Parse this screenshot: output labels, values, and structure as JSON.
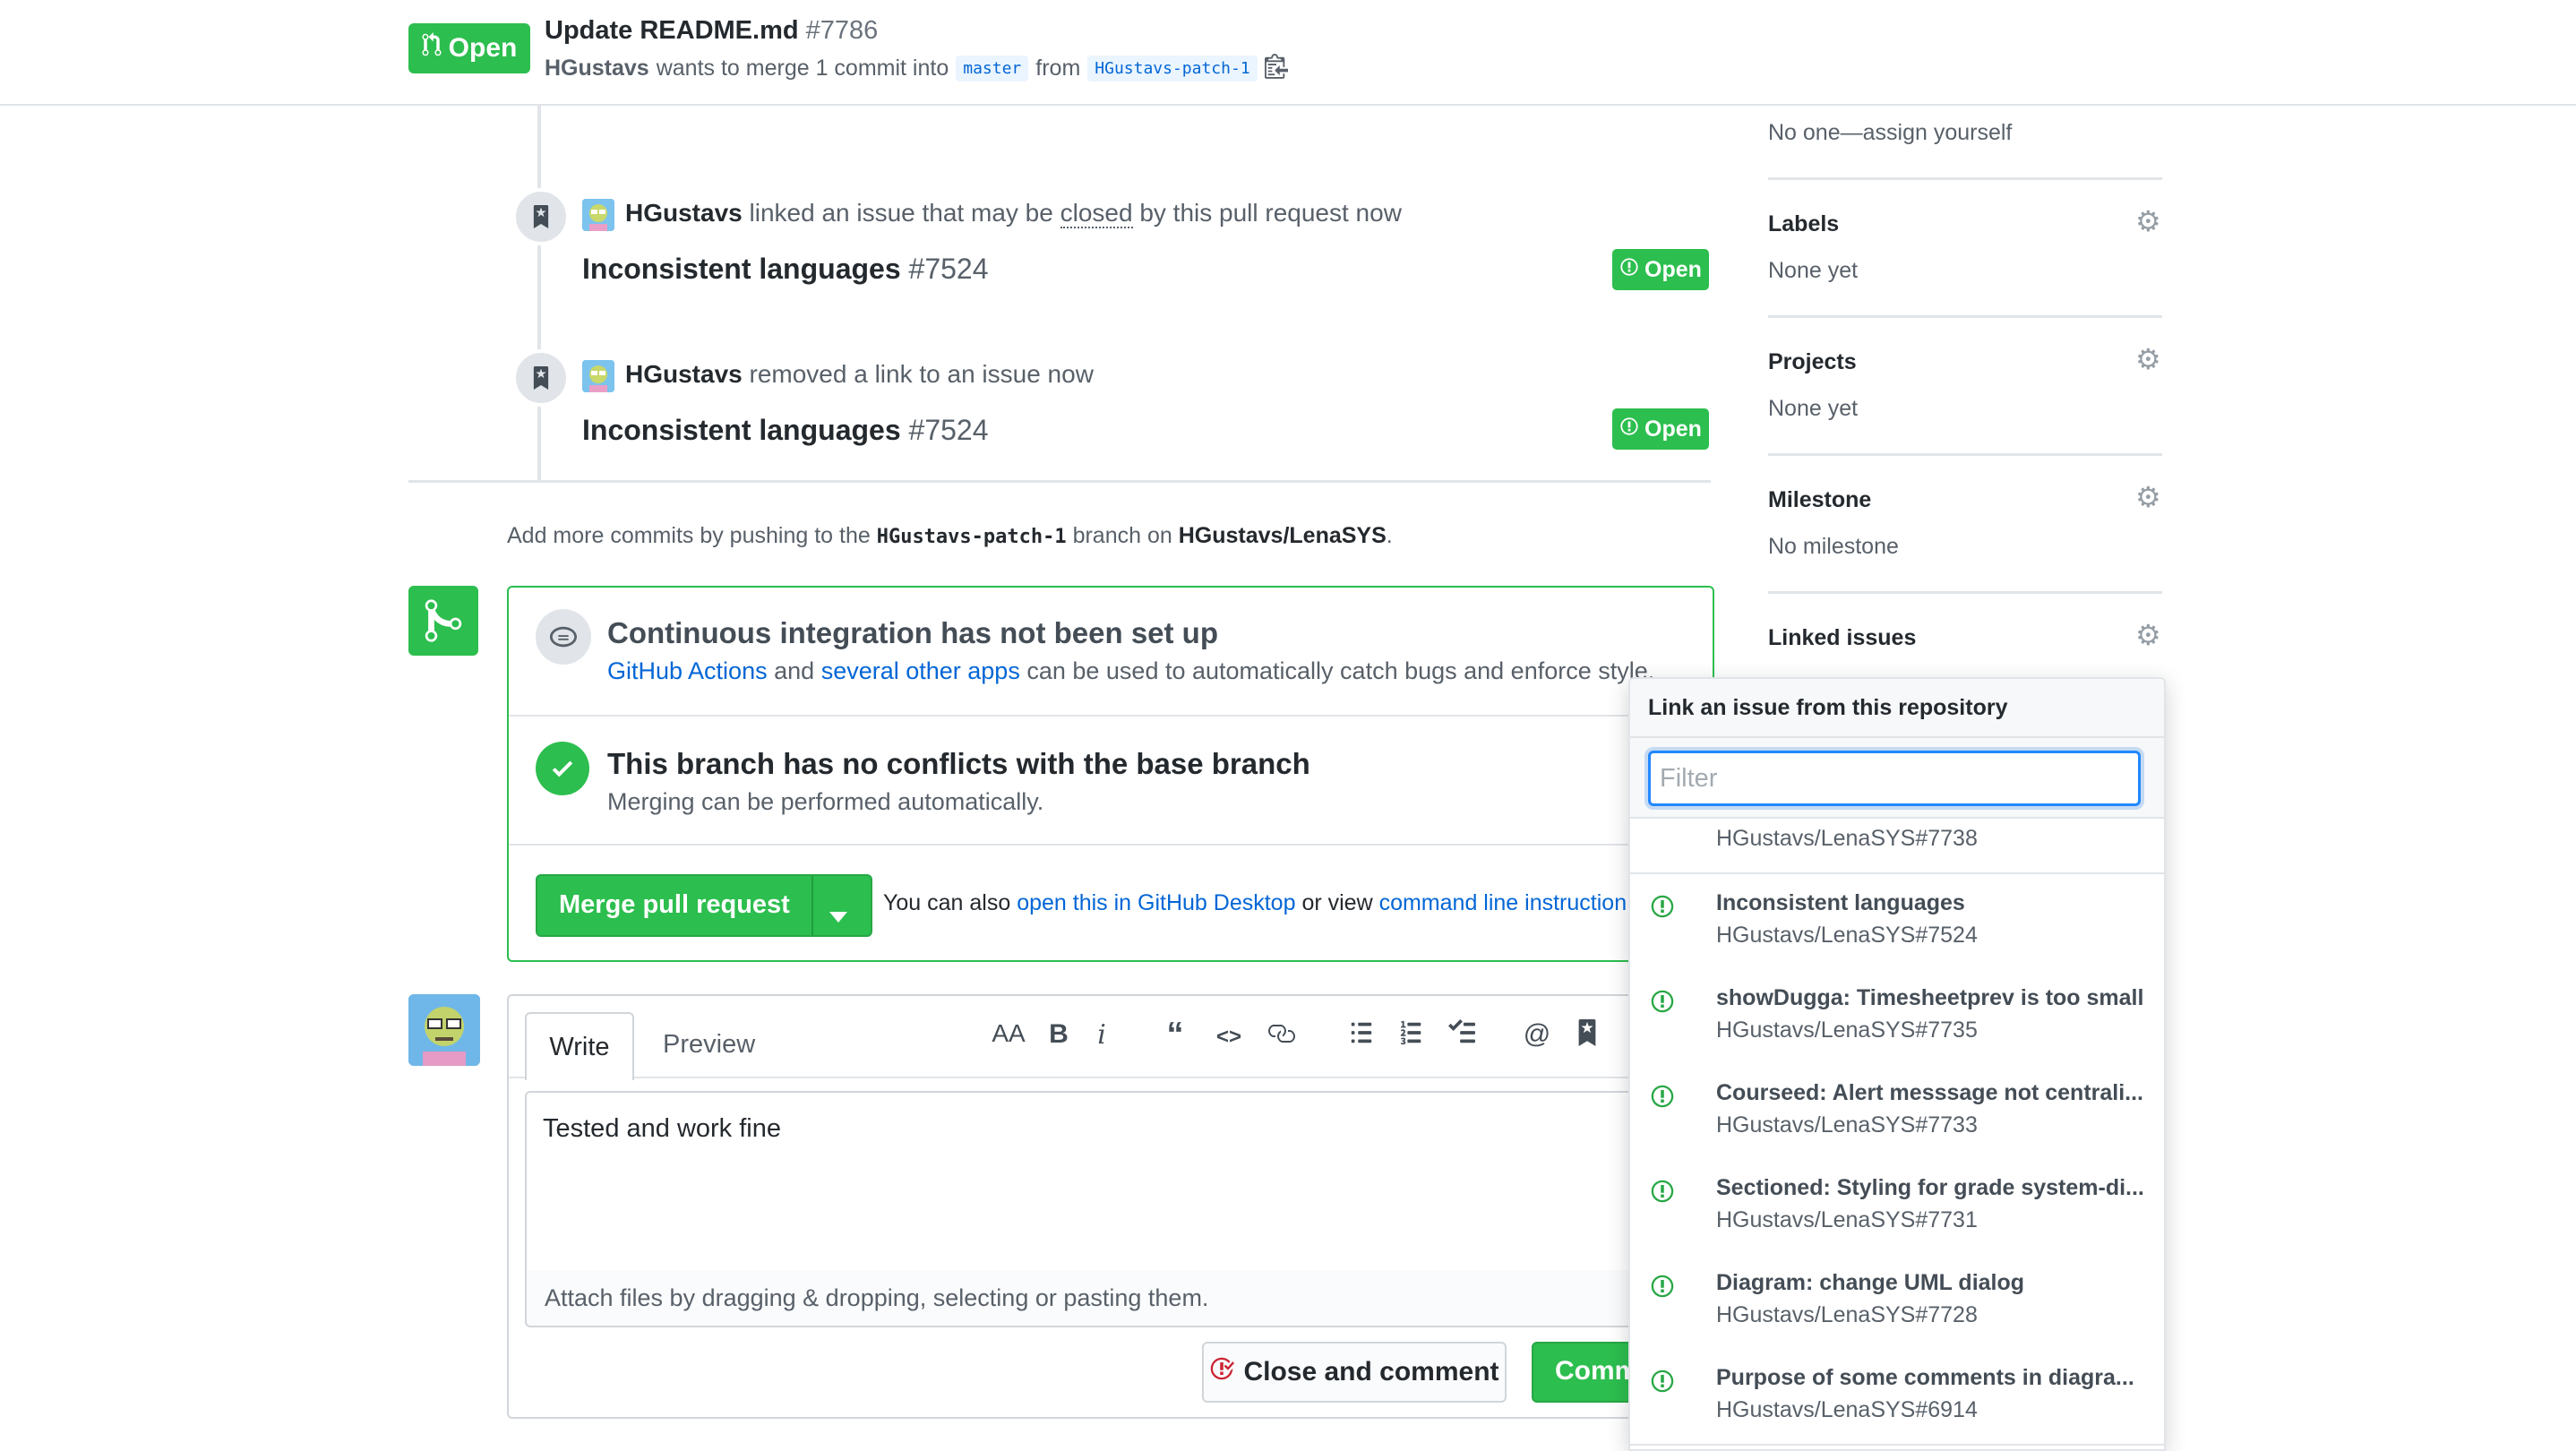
{
  "header": {
    "state": "Open",
    "title": "Update README.md",
    "number": "#7786",
    "author": "HGustavs",
    "merge_text": "wants to merge 1 commit into",
    "base_branch": "master",
    "from_text": "from",
    "head_branch": "HGustavs-patch-1"
  },
  "timeline": {
    "event1": {
      "actor": "HGustavs",
      "text_a": "linked an issue that may be",
      "text_closed": "closed",
      "text_b": "by this pull request now",
      "issue_title": "Inconsistent languages",
      "issue_number": "#7524",
      "badge": "Open"
    },
    "event2": {
      "actor": "HGustavs",
      "text": "removed a link to an issue now",
      "issue_title": "Inconsistent languages",
      "issue_number": "#7524",
      "badge": "Open"
    },
    "push_hint": {
      "a": "Add more commits by pushing to the",
      "branch": "HGustavs-patch-1",
      "b": "branch on",
      "repo": "HGustavs/LenaSYS",
      "c": "."
    }
  },
  "merge_box": {
    "ci_title": "Continuous integration has not been set up",
    "ci_link1": "GitHub Actions",
    "ci_and": "and",
    "ci_link2": "several other apps",
    "ci_rest": "can be used to automatically catch bugs and enforce style.",
    "conflict_title": "This branch has no conflicts with the base branch",
    "conflict_sub": "Merging can be performed automatically.",
    "merge_button": "Merge pull request",
    "also_a": "You can also",
    "also_link1": "open this in GitHub Desktop",
    "also_b": "or view",
    "also_link2": "command line instructions."
  },
  "comment": {
    "tab_write": "Write",
    "tab_preview": "Preview",
    "text": "Tested and work fine",
    "attach_hint": "Attach files by dragging & dropping, selecting or pasting them.",
    "close_button": "Close and comment",
    "comment_button": "Comment"
  },
  "sidebar": {
    "assignees_value": "No one—assign yourself",
    "labels_title": "Labels",
    "labels_value": "None yet",
    "projects_title": "Projects",
    "projects_value": "None yet",
    "milestone_title": "Milestone",
    "milestone_value": "No milestone",
    "linked_title": "Linked issues"
  },
  "dropdown": {
    "header": "Link an issue from this repository",
    "filter_placeholder": "Filter",
    "items": [
      {
        "title": "",
        "ref": "HGustavs/LenaSYS#7738"
      },
      {
        "title": "Inconsistent languages",
        "ref": "HGustavs/LenaSYS#7524"
      },
      {
        "title": "showDugga: Timesheetprev is too small",
        "ref": "HGustavs/LenaSYS#7735"
      },
      {
        "title": "Courseed: Alert messsage not centrali...",
        "ref": "HGustavs/LenaSYS#7733"
      },
      {
        "title": "Sectioned: Styling for grade system-di...",
        "ref": "HGustavs/LenaSYS#7731"
      },
      {
        "title": "Diagram: change UML dialog",
        "ref": "HGustavs/LenaSYS#7728"
      },
      {
        "title": "Purpose of some comments in diagra...",
        "ref": "HGustavs/LenaSYS#6914"
      }
    ]
  },
  "colors": {
    "green": "#2cbe4e",
    "link": "#0366d6",
    "focus": "#2188ff"
  }
}
